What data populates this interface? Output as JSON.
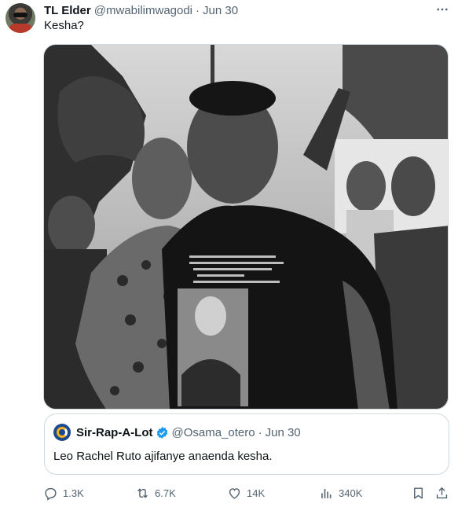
{
  "tweet": {
    "display_name": "TL Elder",
    "handle": "@mwabilimwagodi",
    "separator": "·",
    "date": "Jun 30",
    "text": "Kesha?",
    "more_icon": "more-horizontal-icon",
    "avatar": "user-avatar",
    "media": "photo of a crowd at a protest"
  },
  "quote": {
    "display_name": "Sir-Rap-A-Lot",
    "handle": "@Osama_otero",
    "separator": "·",
    "date": "Jun 30",
    "text": "Leo Rachel Ruto ajifanye anaenda kesha.",
    "verified_icon": "verified-badge-icon",
    "verified_color": "#1d9bf0"
  },
  "actions": {
    "reply": {
      "icon": "reply-icon",
      "count": "1.3K"
    },
    "retweet": {
      "icon": "retweet-icon",
      "count": "6.7K"
    },
    "like": {
      "icon": "heart-icon",
      "count": "14K"
    },
    "views": {
      "icon": "views-icon",
      "count": "340K"
    },
    "bookmark": {
      "icon": "bookmark-icon"
    },
    "share": {
      "icon": "share-icon"
    }
  },
  "colors": {
    "text_primary": "#0f1419",
    "text_secondary": "#536471",
    "border": "#cfd9de"
  }
}
